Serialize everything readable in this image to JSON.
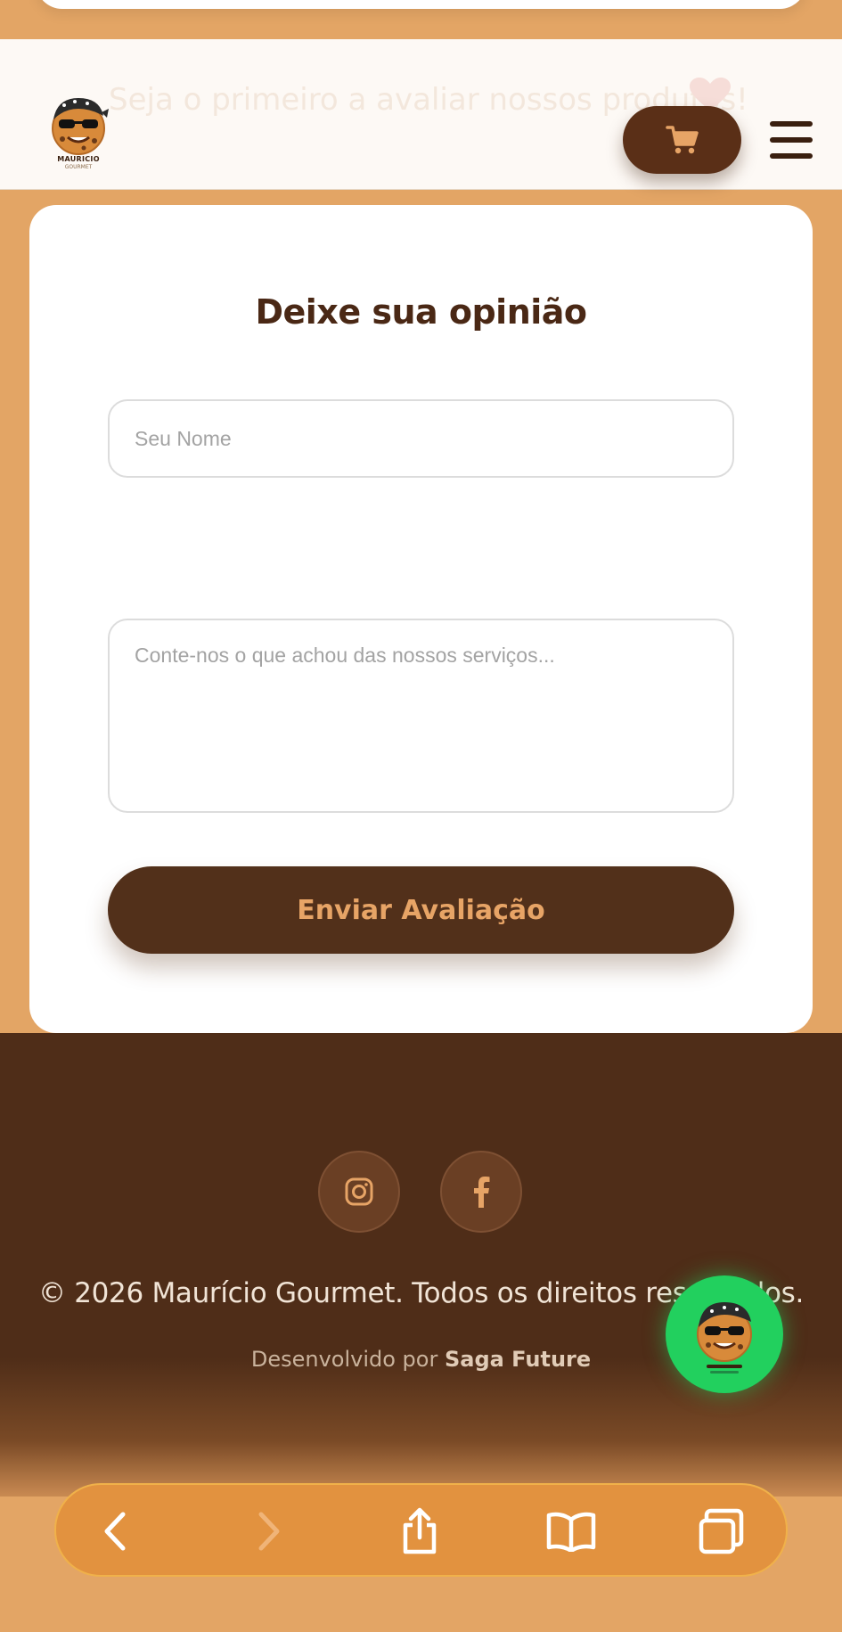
{
  "header": {
    "ghost_text": "Seja o primeiro a avaliar nossos produtos!",
    "logo_text": "MAURICIO",
    "logo_subtext": "GOURMET"
  },
  "review": {
    "title": "Deixe sua opinião",
    "name_placeholder": "Seu Nome",
    "message_placeholder": "Conte-nos o que achou das nossos serviços...",
    "submit_label": "Enviar Avaliação"
  },
  "footer": {
    "copyright": "© 2026 Maurício Gourmet. Todos os direitos reservados.",
    "dev_prefix": "Desenvolvido por ",
    "dev_name": "Saga Future"
  },
  "icons": {
    "cart": "cart-icon",
    "menu": "hamburger-menu-icon",
    "instagram": "instagram-icon",
    "facebook": "facebook-icon",
    "back": "chevron-left-icon",
    "forward": "chevron-right-icon",
    "share": "share-icon",
    "bookmarks": "book-icon",
    "tabs": "tabs-icon"
  },
  "colors": {
    "page_bg": "#e3a565",
    "brown_dark": "#4f2d18",
    "accent_orange": "#e7a466",
    "whatsapp_green": "#22d05e",
    "browser_bar": "#e2923f"
  }
}
